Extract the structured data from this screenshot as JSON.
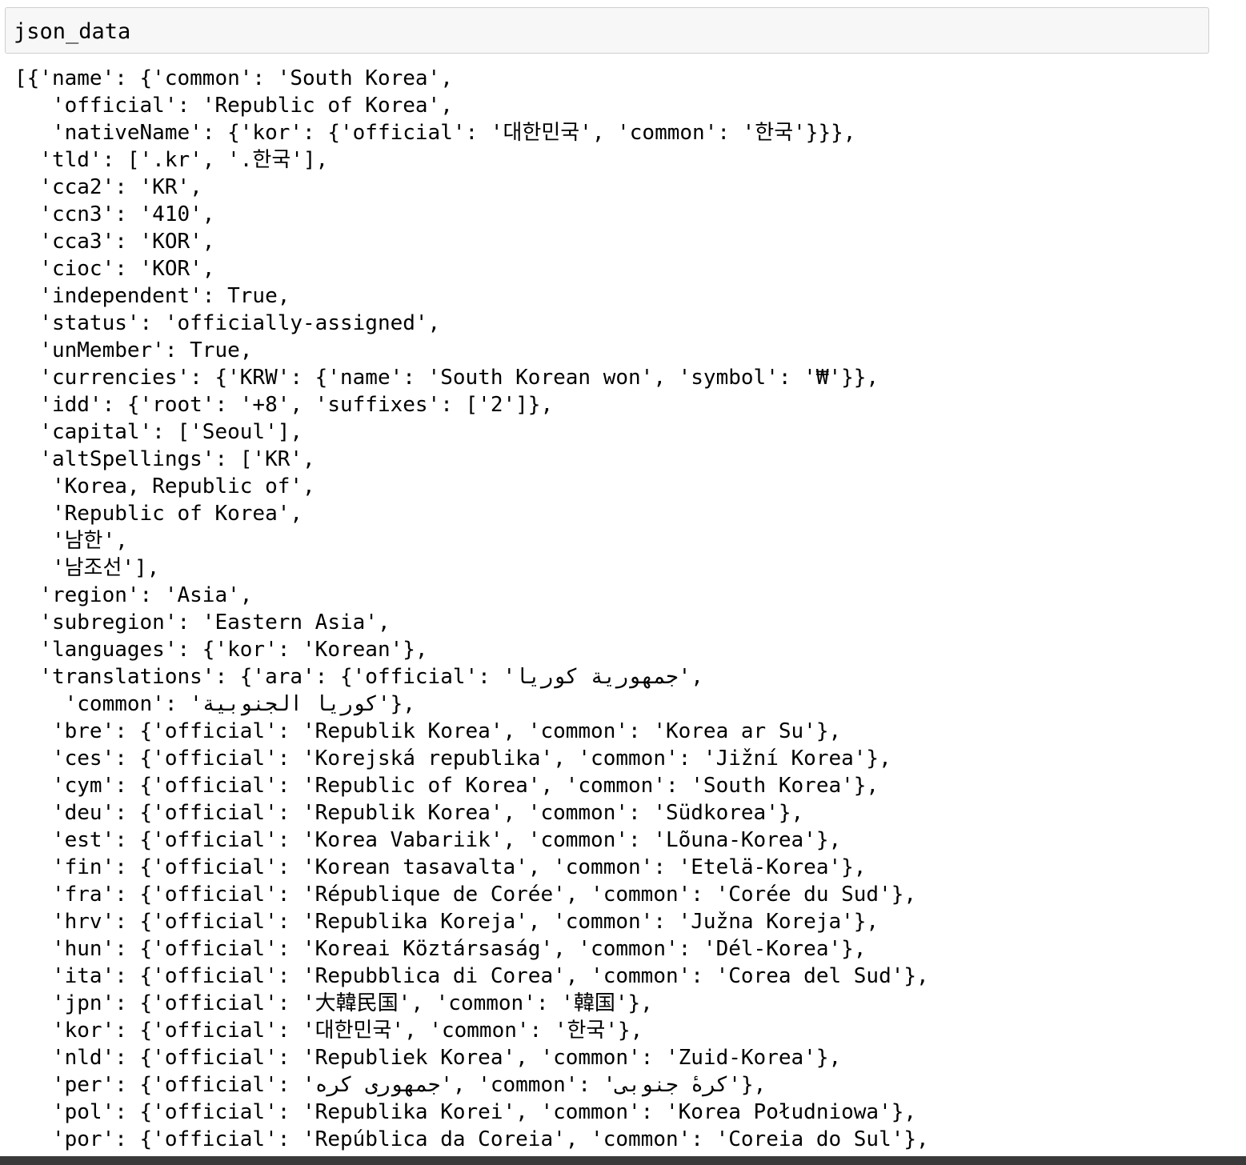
{
  "input_cell": {
    "code": "json_data"
  },
  "output": {
    "lines": [
      "[{'name': {'common': 'South Korea',",
      "   'official': 'Republic of Korea',",
      "   'nativeName': {'kor': {'official': '대한민국', 'common': '한국'}}},",
      "  'tld': ['.kr', '.한국'],",
      "  'cca2': 'KR',",
      "  'ccn3': '410',",
      "  'cca3': 'KOR',",
      "  'cioc': 'KOR',",
      "  'independent': True,",
      "  'status': 'officially-assigned',",
      "  'unMember': True,",
      "  'currencies': {'KRW': {'name': 'South Korean won', 'symbol': '₩'}},",
      "  'idd': {'root': '+8', 'suffixes': ['2']},",
      "  'capital': ['Seoul'],",
      "  'altSpellings': ['KR',",
      "   'Korea, Republic of',",
      "   'Republic of Korea',",
      "   '남한',",
      "   '남조선'],",
      "  'region': 'Asia',",
      "  'subregion': 'Eastern Asia',",
      "  'languages': {'kor': 'Korean'},",
      "  'translations': {'ara': {'official': 'جمهورية كوريا',",
      "    'common': 'كوريا الجنوبية'},",
      "   'bre': {'official': 'Republik Korea', 'common': 'Korea ar Su'},",
      "   'ces': {'official': 'Korejská republika', 'common': 'Jižní Korea'},",
      "   'cym': {'official': 'Republic of Korea', 'common': 'South Korea'},",
      "   'deu': {'official': 'Republik Korea', 'common': 'Südkorea'},",
      "   'est': {'official': 'Korea Vabariik', 'common': 'Lõuna-Korea'},",
      "   'fin': {'official': 'Korean tasavalta', 'common': 'Etelä-Korea'},",
      "   'fra': {'official': 'République de Corée', 'common': 'Corée du Sud'},",
      "   'hrv': {'official': 'Republika Koreja', 'common': 'Južna Koreja'},",
      "   'hun': {'official': 'Koreai Köztársaság', 'common': 'Dél-Korea'},",
      "   'ita': {'official': 'Repubblica di Corea', 'common': 'Corea del Sud'},",
      "   'jpn': {'official': '大韓民国', 'common': '韓国'},",
      "   'kor': {'official': '대한민국', 'common': '한국'},",
      "   'nld': {'official': 'Republiek Korea', 'common': 'Zuid-Korea'},",
      "   'per': {'official': 'جمهوری کره', 'common': 'کرهٔ جنوبی'},",
      "   'pol': {'official': 'Republika Korei', 'common': 'Korea Południowa'},",
      "   'por': {'official': 'República da Coreia', 'common': 'Coreia do Sul'},"
    ]
  }
}
